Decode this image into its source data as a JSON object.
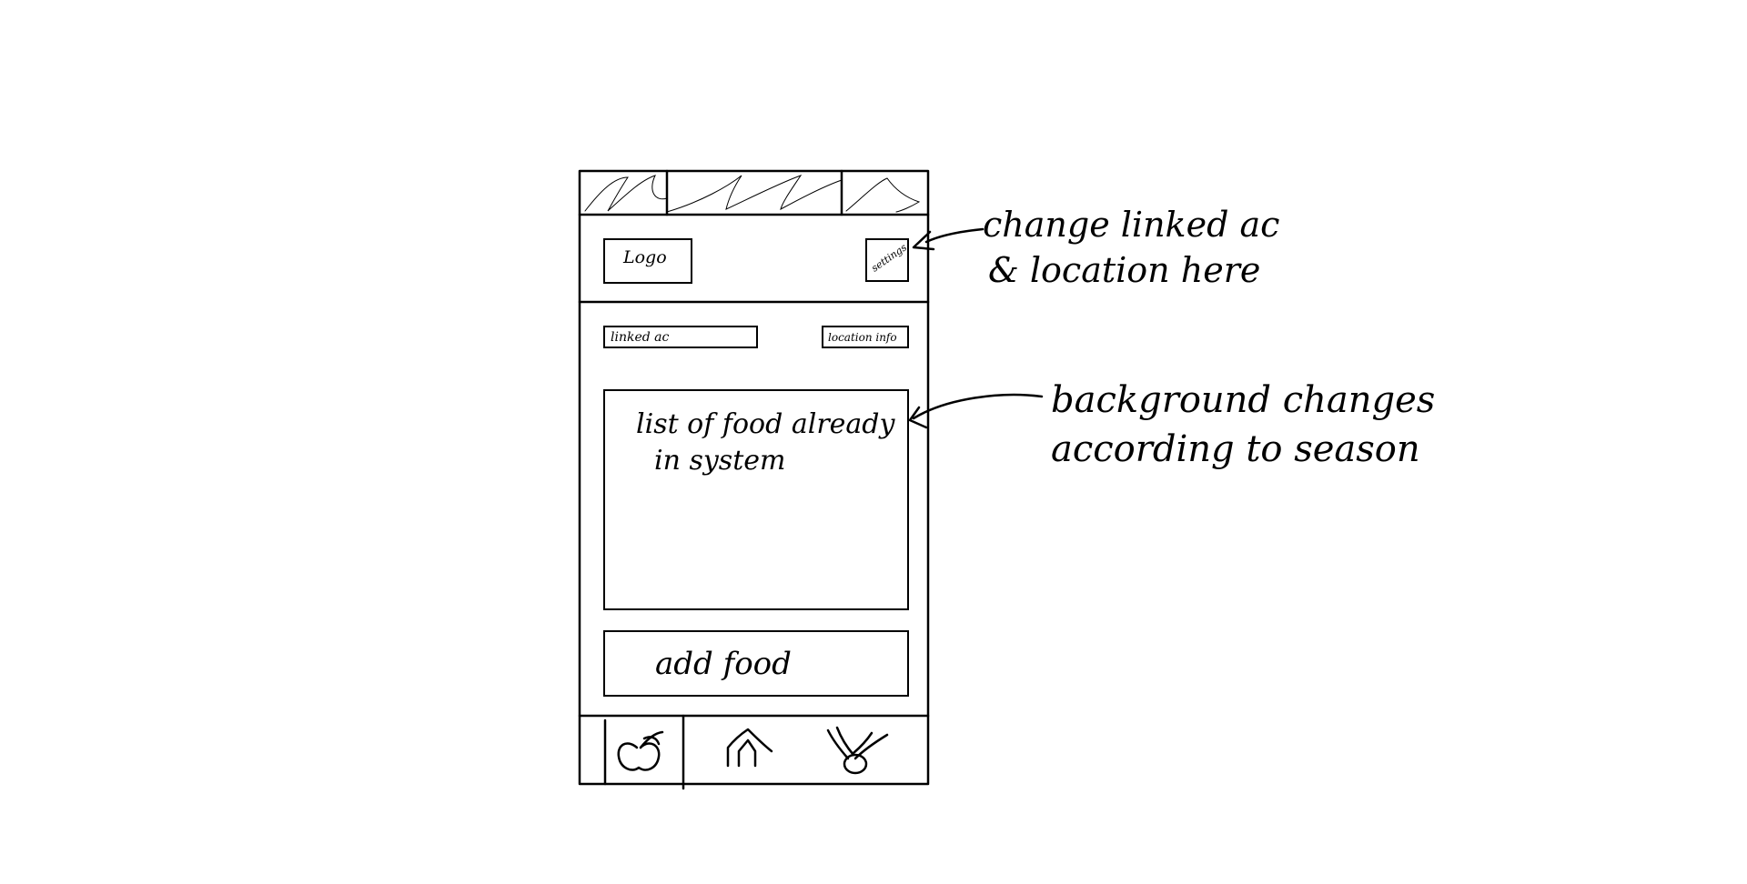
{
  "phone": {
    "header": {
      "logo_label": "Logo",
      "settings_label": "settings"
    },
    "info_bar": {
      "linked_account_label": "linked ac",
      "location_label": "location info"
    },
    "food_list": {
      "line1": "list of food already",
      "line2": "in system"
    },
    "add_food_button": {
      "label": "add food"
    },
    "bottom_nav": {
      "items": [
        {
          "icon": "apple-icon"
        },
        {
          "icon": "home-icon"
        },
        {
          "icon": "tools-icon"
        }
      ]
    }
  },
  "annotations": {
    "settings_note": {
      "line1": "change linked ac",
      "line2": "& location here"
    },
    "background_note": {
      "line1": "background changes",
      "line2": "according to season"
    }
  }
}
